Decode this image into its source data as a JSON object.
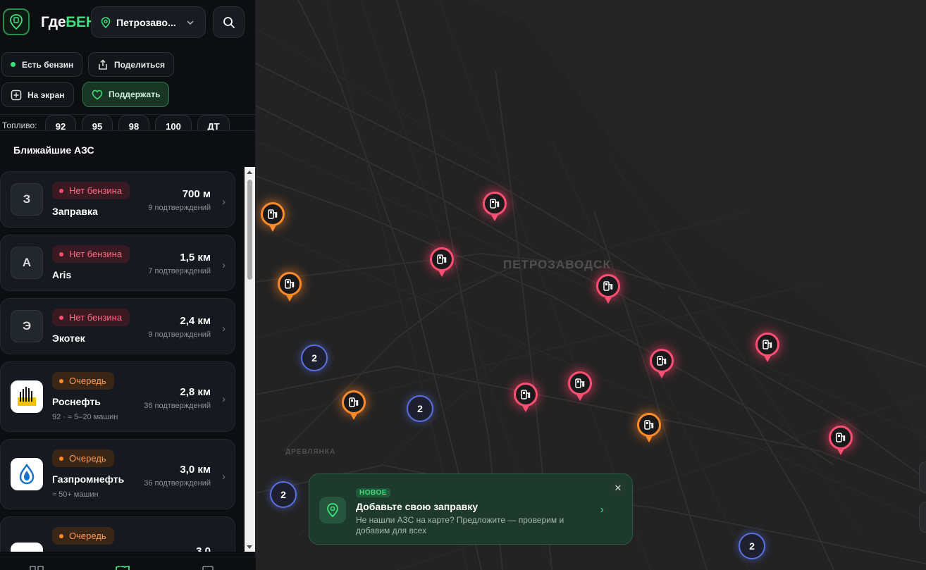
{
  "app": {
    "brand_part1": "Где",
    "brand_part2": "БЕН"
  },
  "header": {
    "city": "Петрозаво..."
  },
  "chips": {
    "has_fuel": "Есть бензин",
    "share": "Поделиться",
    "to_screen": "На экран",
    "support": "Поддержать"
  },
  "fuel": {
    "label": "Топливо:",
    "types": [
      "92",
      "95",
      "98",
      "100",
      "ДТ"
    ]
  },
  "list": {
    "title": "Ближайшие АЗС",
    "stations": [
      {
        "avatar": "З",
        "status": "Нет бензина",
        "name": "Заправка",
        "distance": "700 м",
        "confirmations": "9 подтверждений",
        "extra": ""
      },
      {
        "avatar": "A",
        "status": "Нет бензина",
        "name": "Aris",
        "distance": "1,5 км",
        "confirmations": "7 подтверждений",
        "extra": ""
      },
      {
        "avatar": "Э",
        "status": "Нет бензина",
        "name": "Экотек",
        "distance": "2,4 км",
        "confirmations": "9 подтверждений",
        "extra": ""
      },
      {
        "avatar": "",
        "status": "Очередь",
        "name": "Роснефть",
        "distance": "2,8 км",
        "confirmations": "36 подтверждений",
        "extra": "92 · ≈ 5–20 машин"
      },
      {
        "avatar": "",
        "status": "Очередь",
        "name": "Газпромнефть",
        "distance": "3,0 км",
        "confirmations": "36 подтверждений",
        "extra": "≈ 50+ машин"
      },
      {
        "avatar": "",
        "status": "Очередь",
        "name": "",
        "distance": "3,0",
        "confirmations": "",
        "extra": ""
      }
    ]
  },
  "map": {
    "city_label": "ПЕТРОЗАВОДСК",
    "district_label": "ДРЕВЛЯНКА",
    "clusters": [
      "2",
      "2",
      "2",
      "2"
    ]
  },
  "banner": {
    "badge": "НОВОЕ",
    "title": "Добавьте свою заправку",
    "description": "Не нашли АЗС на карте? Предложите — проверим и добавим для всех",
    "close": "✕",
    "arrow": "›"
  },
  "colors": {
    "accent": "#3ee07e",
    "no_fuel": "#ff4f72",
    "queue": "#ff8a2a",
    "cluster": "#5a6fe0"
  }
}
